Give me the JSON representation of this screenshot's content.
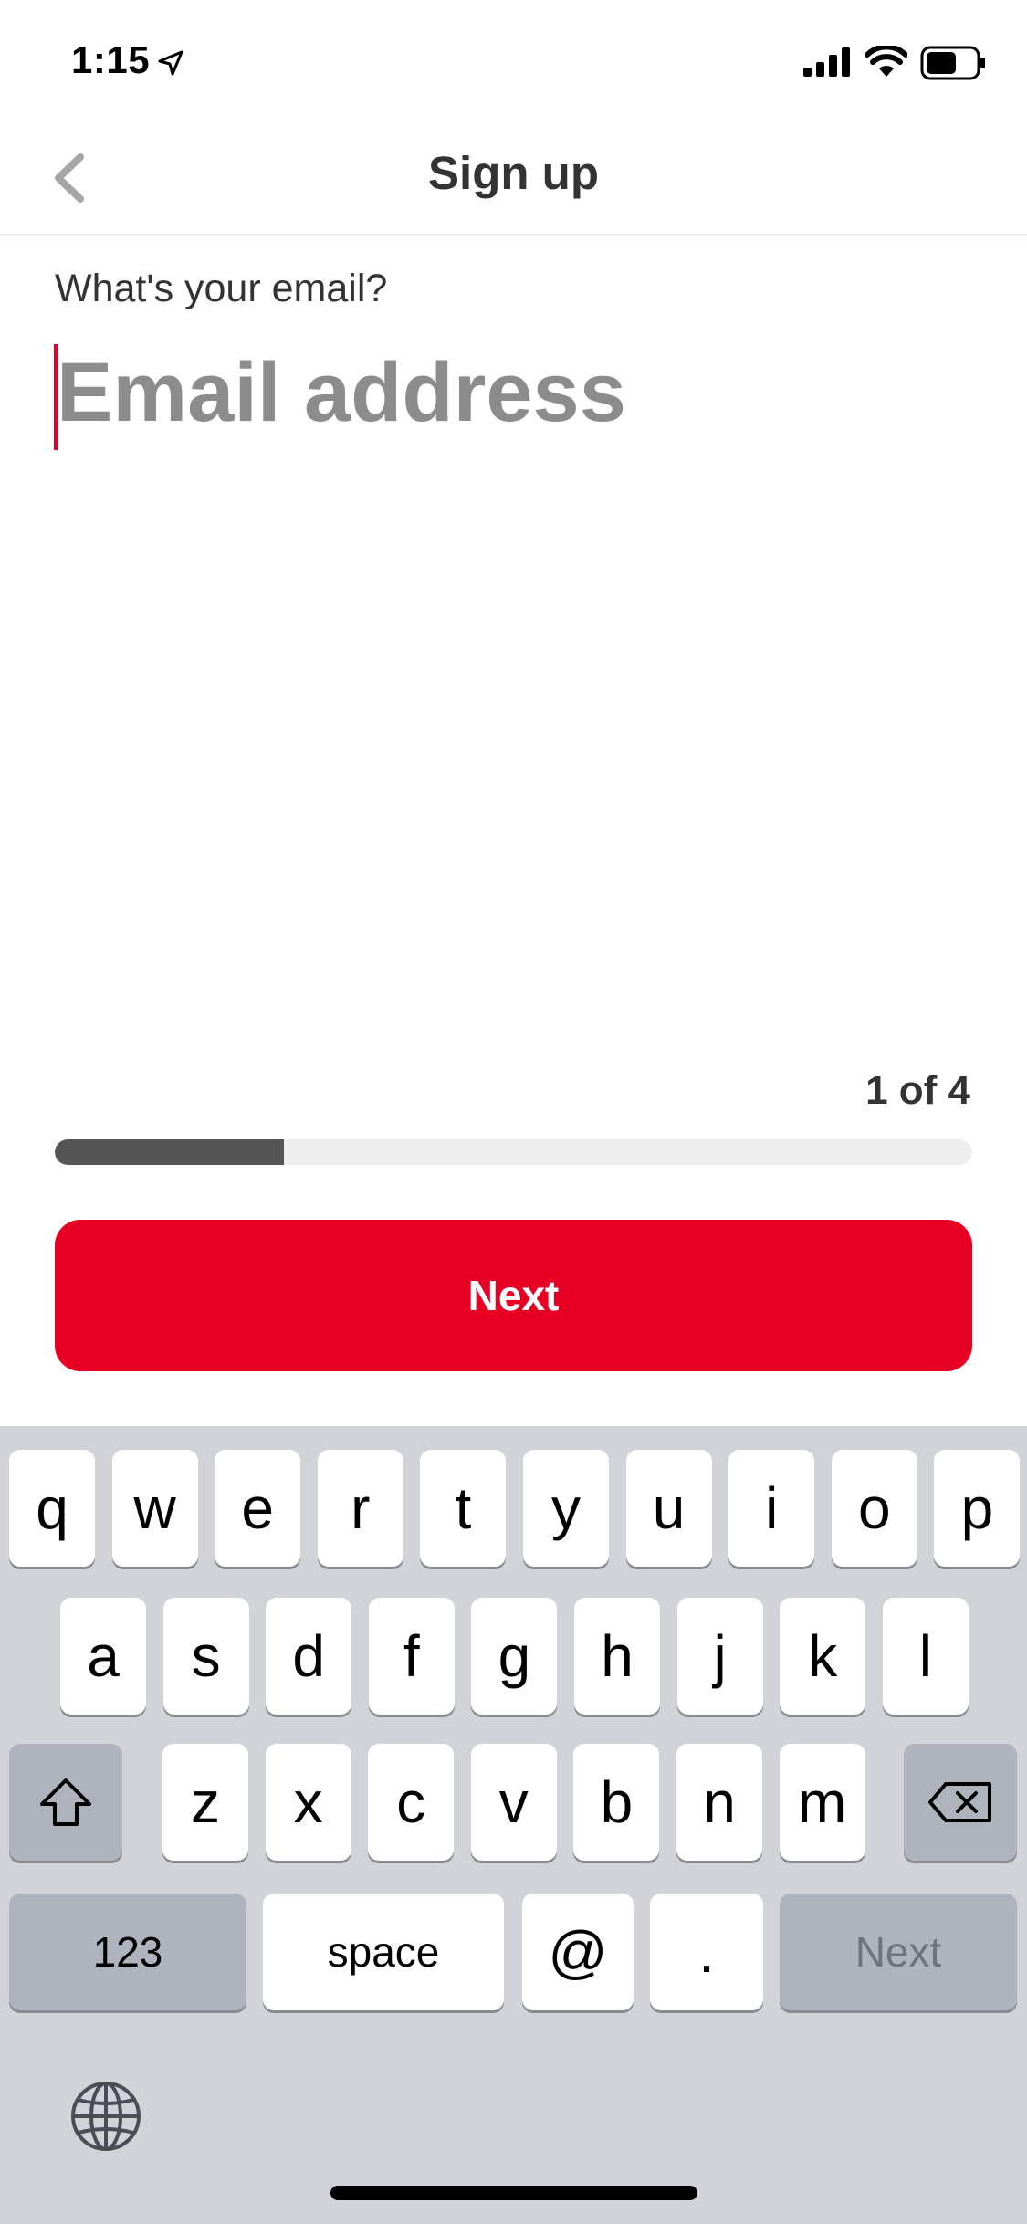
{
  "status_bar": {
    "time": "1:15"
  },
  "nav": {
    "title": "Sign up"
  },
  "form": {
    "question": "What's your email?",
    "email_placeholder": "Email address",
    "email_value": ""
  },
  "progress": {
    "step_label": "1 of 4",
    "fraction": 0.25
  },
  "primary_button": {
    "label": "Next"
  },
  "keyboard": {
    "row1": [
      "q",
      "w",
      "e",
      "r",
      "t",
      "y",
      "u",
      "i",
      "o",
      "p"
    ],
    "row2": [
      "a",
      "s",
      "d",
      "f",
      "g",
      "h",
      "j",
      "k",
      "l"
    ],
    "row3": [
      "z",
      "x",
      "c",
      "v",
      "b",
      "n",
      "m"
    ],
    "numbers_label": "123",
    "space_label": "space",
    "at_label": "@",
    "dot_label": ".",
    "return_label": "Next"
  },
  "colors": {
    "accent": "#e60023",
    "progress_fill": "#555555",
    "progress_track": "#eeeeee",
    "keyboard_bg": "#d1d3d9"
  }
}
